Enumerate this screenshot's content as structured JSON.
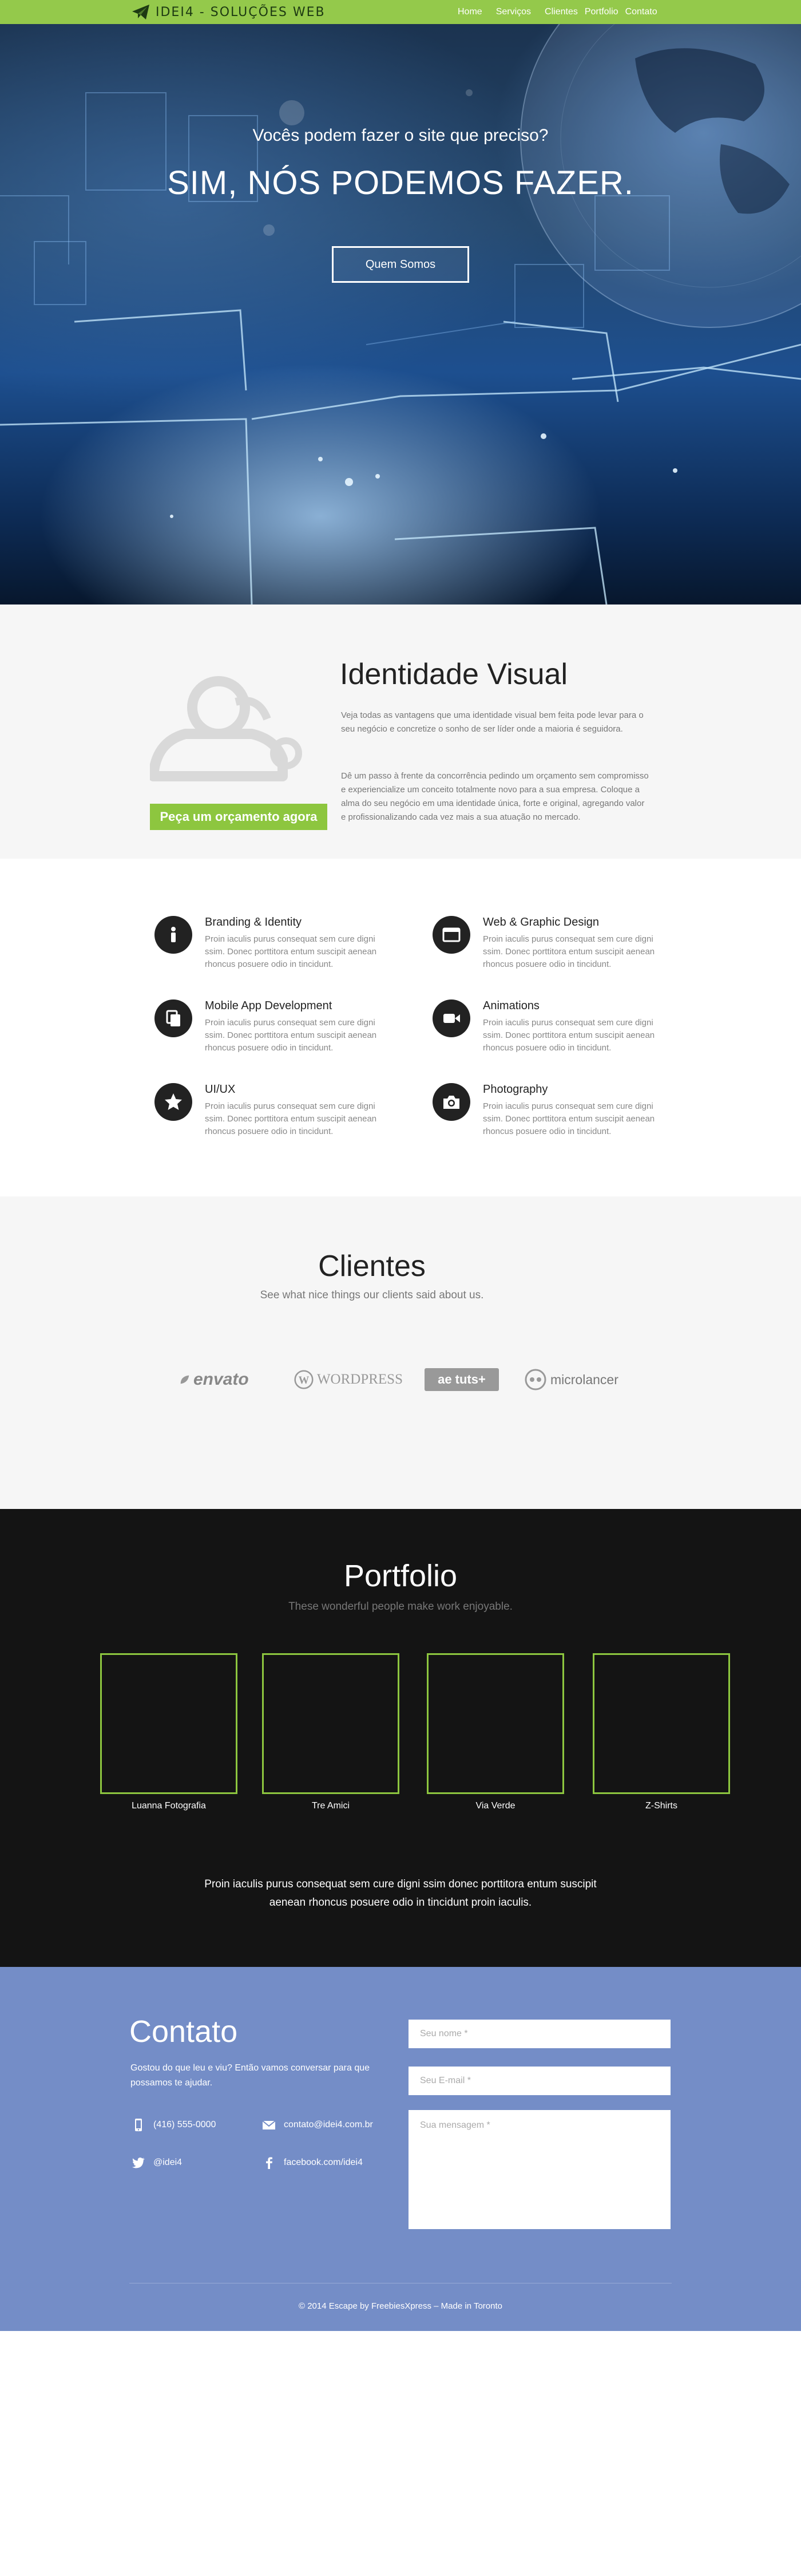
{
  "nav": {
    "brand": "IDEI4 - SOLUÇÕES WEB",
    "brand_icon": "paper-plane-icon",
    "links": [
      "Home",
      "Serviços",
      "Clientes",
      "Portfolio",
      "Contato"
    ]
  },
  "hero": {
    "subtitle": "Vocês podem fazer o site que preciso?",
    "title": "SIM, NÓS PODEMOS FAZER.",
    "button": "Quem Somos"
  },
  "identidade": {
    "title": "Identidade Visual",
    "p1": "Veja todas as vantagens que uma identidade visual bem feita pode levar para o seu negócio e concretize o sonho de ser líder onde a maioria é seguidora.",
    "p2": "Dê um passo à frente da concorrência pedindo um orçamento sem compromisso e experiencialize um conceito totalmente novo para a sua empresa. Coloque a alma do seu negócio em uma identidade única, forte e original, agregando valor e profissionalizando cada vez mais a sua atuação no mercado.",
    "cta": "Peça um orçamento agora",
    "avatar_icon": "users-icon"
  },
  "services": [
    {
      "title": "Branding & Identity",
      "text": "Proin iaculis purus consequat sem cure digni ssim. Donec porttitora entum suscipit aenean rhoncus posuere odio in tincidunt.",
      "icon": "info-icon"
    },
    {
      "title": "Web & Graphic Design",
      "text": "Proin iaculis purus consequat sem cure digni ssim. Donec porttitora entum suscipit aenean rhoncus posuere odio in tincidunt.",
      "icon": "browser-window-icon"
    },
    {
      "title": "Mobile App Development",
      "text": "Proin iaculis purus consequat sem cure digni ssim. Donec porttitora entum suscipit aenean rhoncus posuere odio in tincidunt.",
      "icon": "copy-icon"
    },
    {
      "title": "Animations",
      "text": "Proin iaculis purus consequat sem cure digni ssim. Donec porttitora entum suscipit aenean rhoncus posuere odio in tincidunt.",
      "icon": "video-camera-icon"
    },
    {
      "title": "UI/UX",
      "text": "Proin iaculis purus consequat sem cure digni ssim. Donec porttitora entum suscipit aenean rhoncus posuere odio in tincidunt.",
      "icon": "star-icon"
    },
    {
      "title": "Photography",
      "text": "Proin iaculis purus consequat sem cure digni ssim. Donec porttitora entum suscipit aenean rhoncus posuere odio in tincidunt.",
      "icon": "camera-icon"
    }
  ],
  "clients": {
    "title": "Clientes",
    "subtitle": "See what nice things our clients said about us.",
    "logos": [
      "envato",
      "WORDPRESS",
      "tuts+",
      "microlancer"
    ]
  },
  "portfolio": {
    "title": "Portfolio",
    "subtitle": "These wonderful people make work enjoyable.",
    "items": [
      "Luanna Fotografia",
      "Tre Amici",
      "Via Verde",
      "Z-Shirts"
    ],
    "text": "Proin iaculis purus consequat sem cure digni ssim donec porttitora entum suscipit aenean rhoncus posuere odio in tincidunt proin iaculis."
  },
  "contact": {
    "title": "Contato",
    "intro": "Gostou do que leu e viu? Então vamos conversar para que possamos te ajudar.",
    "phone": "(416) 555-0000",
    "email": "contato@idei4.com.br",
    "twitter": "@idei4",
    "facebook": "facebook.com/idei4",
    "name_placeholder": "Seu nome *",
    "email_placeholder": "Seu E-mail *",
    "message_placeholder": "Sua mensagem *",
    "footer": "© 2014 Escape by FreebiesXpress – Made in Toronto"
  },
  "colors": {
    "accent_green": "#8dc63f",
    "nav_green": "#94c94b",
    "portfolio_bg": "#141414",
    "contact_bg": "#748dc7"
  }
}
